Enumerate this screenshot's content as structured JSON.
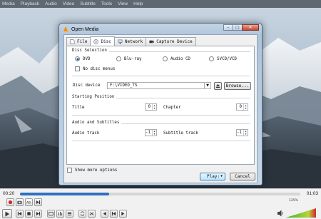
{
  "menubar": [
    "Media",
    "Playback",
    "Audio",
    "Video",
    "Subtitle",
    "Tools",
    "View",
    "Help"
  ],
  "dialog": {
    "title": "Open Media",
    "tabs": [
      "File",
      "Disc",
      "Network",
      "Capture Device"
    ],
    "active_tab": "Disc",
    "disc_selection": {
      "title": "Disc Selection",
      "options": [
        "DVD",
        "Blu-ray",
        "Audio CD",
        "SVCD/VCD"
      ],
      "selected": "DVD",
      "no_menus_label": "No disc menus"
    },
    "disc_device": {
      "label": "Disc device",
      "value": "F:\\VIDEO_TS",
      "browse_label": "Browse..."
    },
    "starting_position": {
      "title": "Starting Position",
      "title_label": "Title",
      "title_value": "0",
      "chapter_label": "Chapter",
      "chapter_value": "0"
    },
    "audio_subtitles": {
      "title": "Audio and Subtitles",
      "audio_label": "Audio track",
      "audio_value": "-1",
      "subtitle_label": "Subtitle track",
      "subtitle_value": "-1"
    },
    "show_more_label": "Show more options",
    "play_label": "Play",
    "cancel_label": "Cancel"
  },
  "player": {
    "time_elapsed": "00:20",
    "time_total": "01:03",
    "progress_fraction": 0.317,
    "volume_label": "125%",
    "volume_fraction": 1.0
  },
  "colors": {
    "accent": "#2f6fbf",
    "volume_green": "#3fae2a",
    "record_red": "#d3262a"
  }
}
